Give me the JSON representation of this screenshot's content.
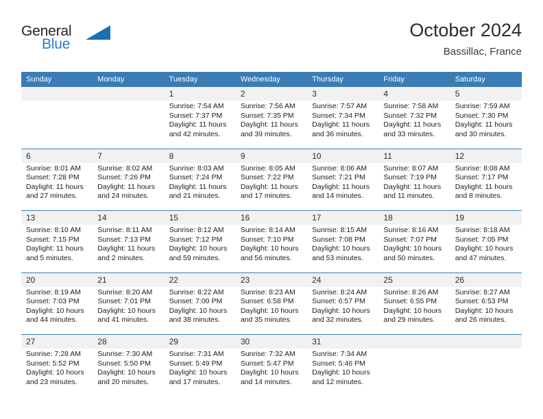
{
  "brand": {
    "name_part1": "General",
    "name_part2": "Blue",
    "triangle_icon": "blue-triangle-logo-mark",
    "color_dark": "#231f20",
    "color_blue": "#2a7cc0"
  },
  "header": {
    "title": "October 2024",
    "subtitle": "Bassillac, France"
  },
  "theme": {
    "header_blue": "#3a7cb5",
    "daynum_gray": "#f1f1f1",
    "text": "#1c1c1c"
  },
  "weekdays": [
    "Sunday",
    "Monday",
    "Tuesday",
    "Wednesday",
    "Thursday",
    "Friday",
    "Saturday"
  ],
  "labels": {
    "sunrise": "Sunrise:",
    "sunset": "Sunset:",
    "daylight": "Daylight:"
  },
  "weeks": [
    {
      "days": [
        {
          "num": "",
          "sunrise": "",
          "sunset": "",
          "daylight_a": "",
          "daylight_b": ""
        },
        {
          "num": "",
          "sunrise": "",
          "sunset": "",
          "daylight_a": "",
          "daylight_b": ""
        },
        {
          "num": "1",
          "sunrise": "Sunrise: 7:54 AM",
          "sunset": "Sunset: 7:37 PM",
          "daylight_a": "Daylight: 11 hours",
          "daylight_b": "and 42 minutes."
        },
        {
          "num": "2",
          "sunrise": "Sunrise: 7:56 AM",
          "sunset": "Sunset: 7:35 PM",
          "daylight_a": "Daylight: 11 hours",
          "daylight_b": "and 39 minutes."
        },
        {
          "num": "3",
          "sunrise": "Sunrise: 7:57 AM",
          "sunset": "Sunset: 7:34 PM",
          "daylight_a": "Daylight: 11 hours",
          "daylight_b": "and 36 minutes."
        },
        {
          "num": "4",
          "sunrise": "Sunrise: 7:58 AM",
          "sunset": "Sunset: 7:32 PM",
          "daylight_a": "Daylight: 11 hours",
          "daylight_b": "and 33 minutes."
        },
        {
          "num": "5",
          "sunrise": "Sunrise: 7:59 AM",
          "sunset": "Sunset: 7:30 PM",
          "daylight_a": "Daylight: 11 hours",
          "daylight_b": "and 30 minutes."
        }
      ]
    },
    {
      "days": [
        {
          "num": "6",
          "sunrise": "Sunrise: 8:01 AM",
          "sunset": "Sunset: 7:28 PM",
          "daylight_a": "Daylight: 11 hours",
          "daylight_b": "and 27 minutes."
        },
        {
          "num": "7",
          "sunrise": "Sunrise: 8:02 AM",
          "sunset": "Sunset: 7:26 PM",
          "daylight_a": "Daylight: 11 hours",
          "daylight_b": "and 24 minutes."
        },
        {
          "num": "8",
          "sunrise": "Sunrise: 8:03 AM",
          "sunset": "Sunset: 7:24 PM",
          "daylight_a": "Daylight: 11 hours",
          "daylight_b": "and 21 minutes."
        },
        {
          "num": "9",
          "sunrise": "Sunrise: 8:05 AM",
          "sunset": "Sunset: 7:22 PM",
          "daylight_a": "Daylight: 11 hours",
          "daylight_b": "and 17 minutes."
        },
        {
          "num": "10",
          "sunrise": "Sunrise: 8:06 AM",
          "sunset": "Sunset: 7:21 PM",
          "daylight_a": "Daylight: 11 hours",
          "daylight_b": "and 14 minutes."
        },
        {
          "num": "11",
          "sunrise": "Sunrise: 8:07 AM",
          "sunset": "Sunset: 7:19 PM",
          "daylight_a": "Daylight: 11 hours",
          "daylight_b": "and 11 minutes."
        },
        {
          "num": "12",
          "sunrise": "Sunrise: 8:08 AM",
          "sunset": "Sunset: 7:17 PM",
          "daylight_a": "Daylight: 11 hours",
          "daylight_b": "and 8 minutes."
        }
      ]
    },
    {
      "days": [
        {
          "num": "13",
          "sunrise": "Sunrise: 8:10 AM",
          "sunset": "Sunset: 7:15 PM",
          "daylight_a": "Daylight: 11 hours",
          "daylight_b": "and 5 minutes."
        },
        {
          "num": "14",
          "sunrise": "Sunrise: 8:11 AM",
          "sunset": "Sunset: 7:13 PM",
          "daylight_a": "Daylight: 11 hours",
          "daylight_b": "and 2 minutes."
        },
        {
          "num": "15",
          "sunrise": "Sunrise: 8:12 AM",
          "sunset": "Sunset: 7:12 PM",
          "daylight_a": "Daylight: 10 hours",
          "daylight_b": "and 59 minutes."
        },
        {
          "num": "16",
          "sunrise": "Sunrise: 8:14 AM",
          "sunset": "Sunset: 7:10 PM",
          "daylight_a": "Daylight: 10 hours",
          "daylight_b": "and 56 minutes."
        },
        {
          "num": "17",
          "sunrise": "Sunrise: 8:15 AM",
          "sunset": "Sunset: 7:08 PM",
          "daylight_a": "Daylight: 10 hours",
          "daylight_b": "and 53 minutes."
        },
        {
          "num": "18",
          "sunrise": "Sunrise: 8:16 AM",
          "sunset": "Sunset: 7:07 PM",
          "daylight_a": "Daylight: 10 hours",
          "daylight_b": "and 50 minutes."
        },
        {
          "num": "19",
          "sunrise": "Sunrise: 8:18 AM",
          "sunset": "Sunset: 7:05 PM",
          "daylight_a": "Daylight: 10 hours",
          "daylight_b": "and 47 minutes."
        }
      ]
    },
    {
      "days": [
        {
          "num": "20",
          "sunrise": "Sunrise: 8:19 AM",
          "sunset": "Sunset: 7:03 PM",
          "daylight_a": "Daylight: 10 hours",
          "daylight_b": "and 44 minutes."
        },
        {
          "num": "21",
          "sunrise": "Sunrise: 8:20 AM",
          "sunset": "Sunset: 7:01 PM",
          "daylight_a": "Daylight: 10 hours",
          "daylight_b": "and 41 minutes."
        },
        {
          "num": "22",
          "sunrise": "Sunrise: 8:22 AM",
          "sunset": "Sunset: 7:00 PM",
          "daylight_a": "Daylight: 10 hours",
          "daylight_b": "and 38 minutes."
        },
        {
          "num": "23",
          "sunrise": "Sunrise: 8:23 AM",
          "sunset": "Sunset: 6:58 PM",
          "daylight_a": "Daylight: 10 hours",
          "daylight_b": "and 35 minutes."
        },
        {
          "num": "24",
          "sunrise": "Sunrise: 8:24 AM",
          "sunset": "Sunset: 6:57 PM",
          "daylight_a": "Daylight: 10 hours",
          "daylight_b": "and 32 minutes."
        },
        {
          "num": "25",
          "sunrise": "Sunrise: 8:26 AM",
          "sunset": "Sunset: 6:55 PM",
          "daylight_a": "Daylight: 10 hours",
          "daylight_b": "and 29 minutes."
        },
        {
          "num": "26",
          "sunrise": "Sunrise: 8:27 AM",
          "sunset": "Sunset: 6:53 PM",
          "daylight_a": "Daylight: 10 hours",
          "daylight_b": "and 26 minutes."
        }
      ]
    },
    {
      "days": [
        {
          "num": "27",
          "sunrise": "Sunrise: 7:28 AM",
          "sunset": "Sunset: 5:52 PM",
          "daylight_a": "Daylight: 10 hours",
          "daylight_b": "and 23 minutes."
        },
        {
          "num": "28",
          "sunrise": "Sunrise: 7:30 AM",
          "sunset": "Sunset: 5:50 PM",
          "daylight_a": "Daylight: 10 hours",
          "daylight_b": "and 20 minutes."
        },
        {
          "num": "29",
          "sunrise": "Sunrise: 7:31 AM",
          "sunset": "Sunset: 5:49 PM",
          "daylight_a": "Daylight: 10 hours",
          "daylight_b": "and 17 minutes."
        },
        {
          "num": "30",
          "sunrise": "Sunrise: 7:32 AM",
          "sunset": "Sunset: 5:47 PM",
          "daylight_a": "Daylight: 10 hours",
          "daylight_b": "and 14 minutes."
        },
        {
          "num": "31",
          "sunrise": "Sunrise: 7:34 AM",
          "sunset": "Sunset: 5:46 PM",
          "daylight_a": "Daylight: 10 hours",
          "daylight_b": "and 12 minutes."
        },
        {
          "num": "",
          "sunrise": "",
          "sunset": "",
          "daylight_a": "",
          "daylight_b": ""
        },
        {
          "num": "",
          "sunrise": "",
          "sunset": "",
          "daylight_a": "",
          "daylight_b": ""
        }
      ]
    }
  ]
}
